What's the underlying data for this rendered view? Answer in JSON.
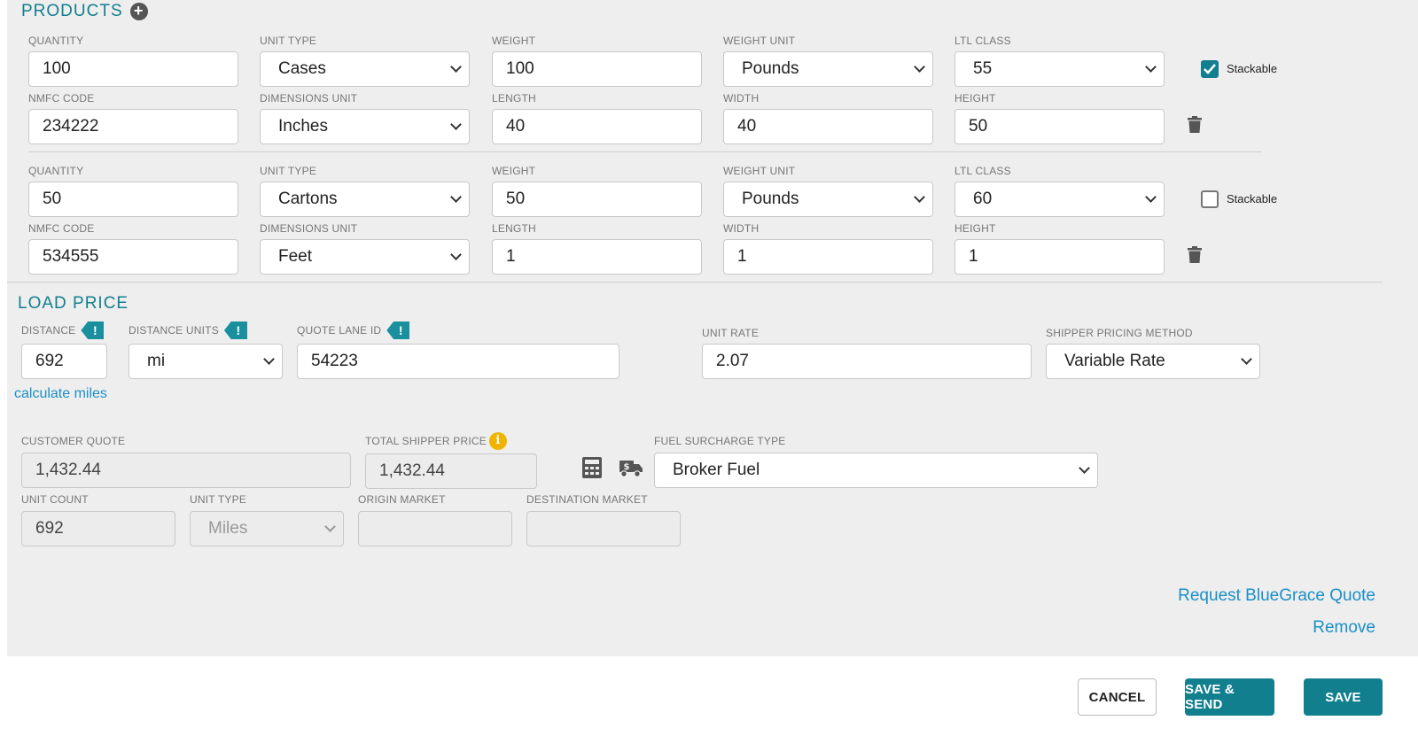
{
  "products": {
    "title": "PRODUCTS",
    "labels": {
      "quantity": "QUANTITY",
      "unit_type": "UNIT TYPE",
      "weight": "WEIGHT",
      "weight_unit": "WEIGHT UNIT",
      "ltl_class": "LTL CLASS",
      "nmfc_code": "NMFC CODE",
      "dimensions_unit": "DIMENSIONS UNIT",
      "length": "LENGTH",
      "width": "WIDTH",
      "height": "HEIGHT",
      "stackable": "Stackable"
    },
    "items": [
      {
        "quantity": "100",
        "unit_type": "Cases",
        "weight": "100",
        "weight_unit": "Pounds",
        "ltl_class": "55",
        "stackable": true,
        "nmfc_code": "234222",
        "dimensions_unit": "Inches",
        "length": "40",
        "width": "40",
        "height": "50"
      },
      {
        "quantity": "50",
        "unit_type": "Cartons",
        "weight": "50",
        "weight_unit": "Pounds",
        "ltl_class": "60",
        "stackable": false,
        "nmfc_code": "534555",
        "dimensions_unit": "Feet",
        "length": "1",
        "width": "1",
        "height": "1"
      }
    ]
  },
  "load_price": {
    "title": "LOAD PRICE",
    "labels": {
      "distance": "DISTANCE",
      "distance_units": "DISTANCE UNITS",
      "quote_lane_id": "QUOTE LANE ID",
      "unit_rate": "UNIT RATE",
      "shipper_pricing_method": "SHIPPER PRICING METHOD",
      "customer_quote": "CUSTOMER QUOTE",
      "total_shipper_price": "TOTAL SHIPPER PRICE",
      "fuel_surcharge_type": "FUEL SURCHARGE TYPE",
      "unit_count": "UNIT COUNT",
      "unit_type": "UNIT TYPE",
      "origin_market": "ORIGIN MARKET",
      "destination_market": "DESTINATION MARKET"
    },
    "values": {
      "distance": "692",
      "distance_units": "mi",
      "quote_lane_id": "54223",
      "unit_rate": "2.07",
      "shipper_pricing_method": "Variable Rate",
      "customer_quote": "1,432.44",
      "total_shipper_price": "1,432.44",
      "fuel_surcharge_type": "Broker Fuel",
      "unit_count": "692",
      "unit_type": "Miles",
      "origin_market": "",
      "destination_market": ""
    },
    "calculate_miles_link": "calculate miles",
    "request_quote_link": "Request BlueGrace Quote",
    "remove_link": "Remove"
  },
  "footer": {
    "cancel": "CANCEL",
    "save_send": "SAVE & SEND",
    "save": "SAVE"
  },
  "colors": {
    "accent": "#127f8f",
    "link": "#1a8fc7",
    "panel": "#eeeeee",
    "warning_tag": "#1a8f9e",
    "info": "#f0b400"
  },
  "icons": [
    "plus-icon",
    "trash-icon",
    "warning-icon",
    "info-icon",
    "calculator-icon",
    "fuel-truck-icon",
    "check-icon",
    "chevron-down-icon"
  ]
}
